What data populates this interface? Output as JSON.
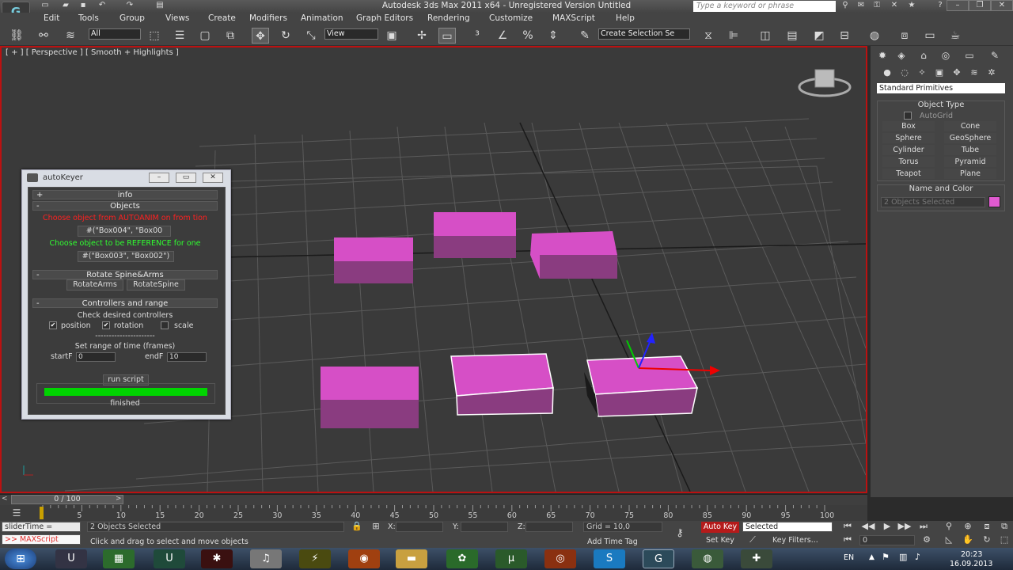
{
  "window": {
    "title": "Autodesk 3ds Max  2011 x64  -  Unregistered Version     Untitled",
    "search_placeholder": "Type a keyword or phrase"
  },
  "menus": [
    "Edit",
    "Tools",
    "Group",
    "Views",
    "Create",
    "Modifiers",
    "Animation",
    "Graph Editors",
    "Rendering",
    "Customize",
    "MAXScript",
    "Help"
  ],
  "toolbar": {
    "selection_filter": "All",
    "ref_coord": "View",
    "named_selection": "Create Selection Se"
  },
  "viewport": {
    "label": "[ + ] [ Perspective ] [ Smooth + Highlights ]",
    "axis_x": "x",
    "axis_y": "y",
    "axis_z": "z"
  },
  "autokeyer": {
    "title": "autoKeyer",
    "info_rollout": "info",
    "objects_rollout": "Objects",
    "choose_anim_text": "Choose object from AUTOANIM on from tion",
    "anim_objects_button": "#(\"Box004\", \"Box00",
    "choose_ref_text": "Choose object to be REFERENCE for one",
    "ref_objects_button": "#(\"Box003\", \"Box002\")",
    "rotate_rollout": "Rotate Spine&Arms",
    "rotate_arms_button": "RotateArms",
    "rotate_spine_button": "RotateSpine",
    "controllers_rollout": "Controllers and range",
    "check_controllers_text": "Check desired controllers",
    "position_label": "position",
    "rotation_label": "rotation",
    "scale_label": "scale",
    "separator_text": "----------------------",
    "set_range_text": "Set range of time (frames)",
    "startf_label": "startF",
    "startf_value": "0",
    "endf_label": "endF",
    "endf_value": "10",
    "run_button": "run script",
    "progress": 1.0,
    "status_text": "finished"
  },
  "command_panel": {
    "category": "Standard Primitives",
    "object_type_title": "Object Type",
    "autogrid_label": "AutoGrid",
    "buttons": [
      "Box",
      "Cone",
      "Sphere",
      "GeoSphere",
      "Cylinder",
      "Tube",
      "Torus",
      "Pyramid",
      "Teapot",
      "Plane"
    ],
    "name_color_title": "Name and Color",
    "name_value": "2 Objects Selected",
    "swatch_color": "#e05ad0"
  },
  "timeline": {
    "frame_display": "0 / 100",
    "ticks": [
      "5",
      "10",
      "15",
      "20",
      "25",
      "30",
      "35",
      "40",
      "45",
      "50",
      "55",
      "60",
      "65",
      "70",
      "75",
      "80",
      "85",
      "90",
      "95",
      "100"
    ]
  },
  "status": {
    "maxscript_listener_1": "sliderTime  =",
    "maxscript_listener_2": ">> MAXScript",
    "selection_text": "2 Objects Selected",
    "prompt_text": "Click and drag to select and move objects",
    "x_label": "X:",
    "y_label": "Y:",
    "z_label": "Z:",
    "grid_text": "Grid = 10,0",
    "add_time_tag": "Add Time Tag",
    "auto_key": "Auto Key",
    "set_key": "Set Key",
    "key_mode": "Selected",
    "key_filters": "Key Filters...",
    "current_frame": "0"
  },
  "taskbar": {
    "language": "EN",
    "time": "20:23",
    "date": "16.09.2013"
  },
  "colors": {
    "box_pink": "#d64fc6",
    "accent_red": "#c01010",
    "progress_green": "#00d400"
  }
}
